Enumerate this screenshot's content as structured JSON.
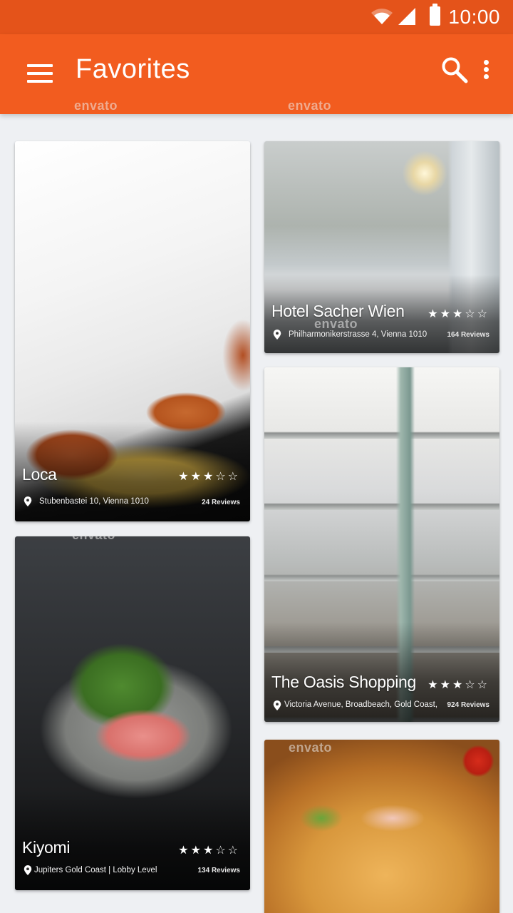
{
  "status_bar": {
    "time": "10:00",
    "icons": [
      "wifi-icon",
      "signal-icon",
      "battery-icon"
    ]
  },
  "app_bar": {
    "title": "Favorites",
    "background_color": "#f25c1f",
    "status_color": "#e4531a",
    "actions": [
      "menu-icon",
      "search-icon",
      "more-vert-icon"
    ]
  },
  "cards": [
    {
      "name": "Loca",
      "rating": 3,
      "max_rating": 5,
      "stars": "★★★☆☆",
      "address": "Stubenbastei 10, Vienna 1010",
      "reviews": "24 Reviews"
    },
    {
      "name": "Hotel Sacher Wien",
      "rating": 3,
      "max_rating": 5,
      "stars": "★★★☆☆",
      "address": "Philharmonikerstrasse 4, Vienna 1010",
      "reviews": "164 Reviews"
    },
    {
      "name": "The Oasis Shopping",
      "rating": 3,
      "max_rating": 5,
      "stars": "★★★☆☆",
      "address": "Victoria Avenue, Broadbeach, Gold Coast,",
      "reviews": "924 Reviews"
    },
    {
      "name": "Kiyomi",
      "rating": 3,
      "max_rating": 5,
      "stars": "★★★☆☆",
      "address": "Jupiters Gold Coast | Lobby Level",
      "reviews": "134 Reviews"
    },
    {
      "name": "",
      "address": "",
      "reviews": ""
    }
  ],
  "watermark": "envato"
}
